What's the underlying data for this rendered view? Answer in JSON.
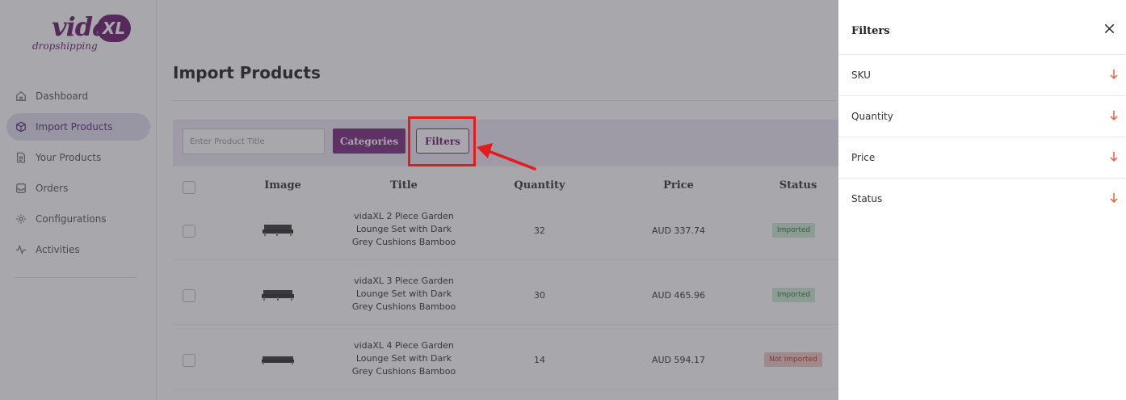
{
  "logo": {
    "word": "vida",
    "badge": "XL",
    "sub": "dropshipping"
  },
  "sidebar": {
    "items": [
      {
        "label": "Dashboard",
        "icon": "home-icon"
      },
      {
        "label": "Import Products",
        "icon": "box-icon",
        "active": true
      },
      {
        "label": "Your Products",
        "icon": "document-icon"
      },
      {
        "label": "Orders",
        "icon": "inbox-icon"
      },
      {
        "label": "Configurations",
        "icon": "gear-icon"
      },
      {
        "label": "Activities",
        "icon": "activity-icon"
      }
    ]
  },
  "main": {
    "title": "Import Products",
    "search": {
      "placeholder": "Enter Product Title",
      "value": ""
    },
    "categories_label": "Categories",
    "filters_label": "Filters"
  },
  "table": {
    "columns": {
      "image": "Image",
      "title": "Title",
      "quantity": "Quantity",
      "price": "Price",
      "status": "Status"
    },
    "rows": [
      {
        "title": [
          "vidaXL 2 Piece Garden",
          "Lounge Set with Dark",
          "Grey Cushions Bamboo"
        ],
        "quantity": "32",
        "price": "AUD 337.74",
        "status": "Imported"
      },
      {
        "title": [
          "vidaXL 3 Piece Garden",
          "Lounge Set with Dark",
          "Grey Cushions Bamboo"
        ],
        "quantity": "30",
        "price": "AUD 465.96",
        "status": "Imported"
      },
      {
        "title": [
          "vidaXL 4 Piece Garden",
          "Lounge Set with Dark",
          "Grey Cushions Bamboo"
        ],
        "quantity": "14",
        "price": "AUD 594.17",
        "status": "Not Imported"
      }
    ]
  },
  "drawer": {
    "title": "Filters",
    "items": [
      {
        "label": "SKU"
      },
      {
        "label": "Quantity"
      },
      {
        "label": "Price"
      },
      {
        "label": "Status"
      }
    ]
  },
  "colors": {
    "brand": "#6b1a6b",
    "highlight": "#e31b1b",
    "filter_arrow": "#e8603c"
  }
}
